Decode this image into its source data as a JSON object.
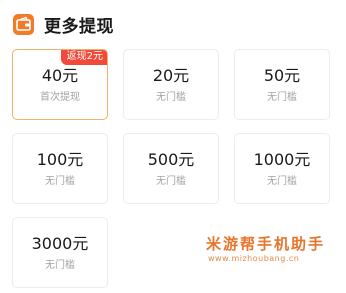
{
  "header": {
    "title": "更多提现",
    "icon": "wallet-icon",
    "icon_color": "#F07B29"
  },
  "options": [
    {
      "amount": "40元",
      "sub": "首次提现",
      "badge": "返现2元",
      "selected": true
    },
    {
      "amount": "20元",
      "sub": "无门槛",
      "badge": null,
      "selected": false
    },
    {
      "amount": "50元",
      "sub": "无门槛",
      "badge": null,
      "selected": false
    },
    {
      "amount": "100元",
      "sub": "无门槛",
      "badge": null,
      "selected": false
    },
    {
      "amount": "500元",
      "sub": "无门槛",
      "badge": null,
      "selected": false
    },
    {
      "amount": "1000元",
      "sub": "无门槛",
      "badge": null,
      "selected": false
    },
    {
      "amount": "3000元",
      "sub": "无门槛",
      "badge": null,
      "selected": false
    }
  ],
  "watermark": {
    "title": "米游帮手机助手",
    "url": "www.mizhoubang.cn"
  },
  "colors": {
    "accent": "#F07B29",
    "badge": "#F24A3A",
    "selected_border": "#F2B06A"
  }
}
